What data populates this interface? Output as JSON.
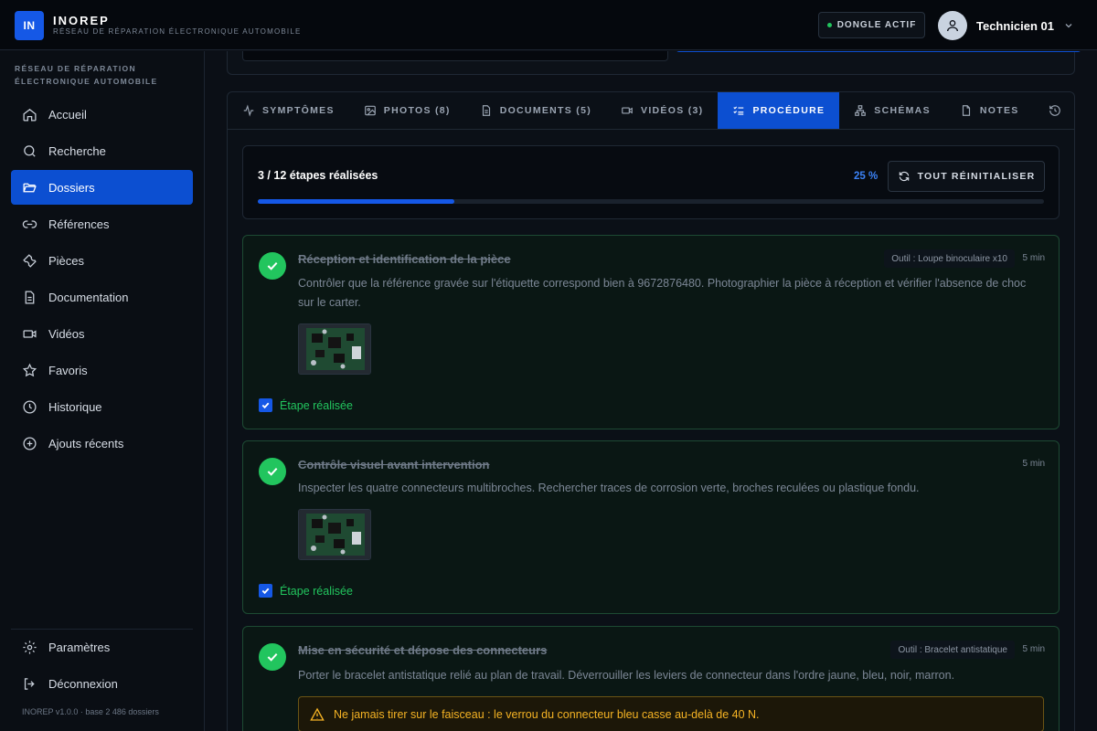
{
  "brand": {
    "logo": "IN",
    "name": "INOREP",
    "subtitle": "RÉSEAU DE RÉPARATION ÉLECTRONIQUE AUTOMOBILE"
  },
  "header": {
    "dongle_label": "DONGLE ACTIF",
    "user_name": "Technicien 01"
  },
  "sidebar": {
    "header": "RÉSEAU DE RÉPARATION ÉLECTRONIQUE AUTOMOBILE",
    "items": [
      {
        "label": "Accueil",
        "icon": "home-icon"
      },
      {
        "label": "Recherche",
        "icon": "search-icon"
      },
      {
        "label": "Dossiers",
        "icon": "folder-open-icon"
      },
      {
        "label": "Références",
        "icon": "link-icon"
      },
      {
        "label": "Pièces",
        "icon": "wrench-icon"
      },
      {
        "label": "Documentation",
        "icon": "document-icon"
      },
      {
        "label": "Vidéos",
        "icon": "video-icon"
      },
      {
        "label": "Favoris",
        "icon": "star-icon"
      },
      {
        "label": "Historique",
        "icon": "clock-icon"
      },
      {
        "label": "Ajouts récents",
        "icon": "plus-circle-icon"
      }
    ],
    "active_item": "Dossiers",
    "bottom_items": [
      {
        "label": "Paramètres",
        "icon": "gear-icon"
      },
      {
        "label": "Déconnexion",
        "icon": "logout-icon"
      }
    ],
    "version": "INOREP v1.0.0 · base 2 486 dossiers"
  },
  "tabs": [
    {
      "label": "SYMPTÔMES",
      "icon": "activity-icon"
    },
    {
      "label": "PHOTOS (8)",
      "icon": "image-icon"
    },
    {
      "label": "DOCUMENTS (5)",
      "icon": "document-icon"
    },
    {
      "label": "VIDÉOS (3)",
      "icon": "video-icon"
    },
    {
      "label": "PROCÉDURE",
      "icon": "checklist-icon"
    },
    {
      "label": "SCHÉMAS",
      "icon": "schema-icon"
    },
    {
      "label": "NOTES",
      "icon": "note-icon"
    }
  ],
  "active_tab": "PROCÉDURE",
  "progress": {
    "label": "3 / 12 étapes réalisées",
    "percent_text": "25 %",
    "percent": 0.25,
    "reset_label": "TOUT RÉINITIALISER"
  },
  "steps": [
    {
      "title": "Réception et identification de la pièce",
      "tool": "Outil : Loupe binoculaire x10",
      "duration": "5 min",
      "description": "Contrôler que la référence gravée sur l'étiquette correspond bien à 9672876480. Photographier la pièce à réception et vérifier l'absence de choc sur le carter.",
      "done_label": "Étape réalisée"
    },
    {
      "title": "Contrôle visuel avant intervention",
      "duration": "5 min",
      "description": "Inspecter les quatre connecteurs multibroches. Rechercher traces de corrosion verte, broches reculées ou plastique fondu.",
      "done_label": "Étape réalisée"
    },
    {
      "title": "Mise en sécurité et dépose des connecteurs",
      "tool": "Outil : Bracelet antistatique",
      "duration": "5 min",
      "description": "Porter le bracelet antistatique relié au plan de travail. Déverrouiller les leviers de connecteur dans l'ordre jaune, bleu, noir, marron.",
      "warning": "Ne jamais tirer sur le faisceau : le verrou du connecteur bleu casse au-delà de 40 N."
    }
  ]
}
